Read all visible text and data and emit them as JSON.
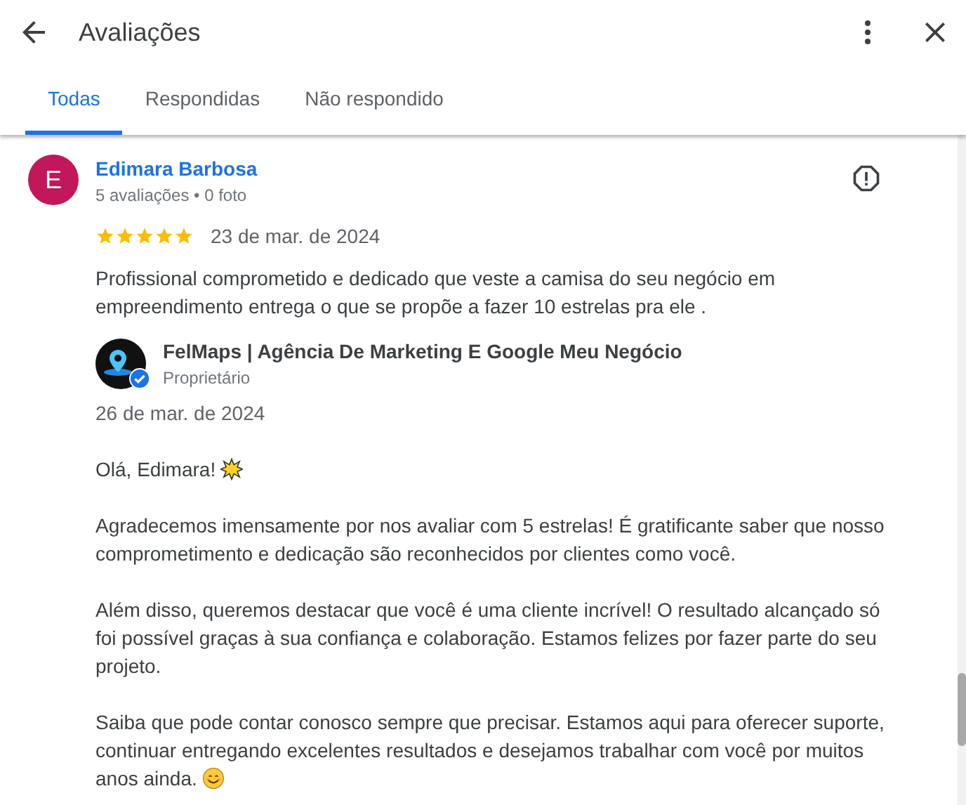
{
  "header": {
    "title": "Avaliações"
  },
  "tabs": [
    {
      "label": "Todas",
      "selected": true
    },
    {
      "label": "Respondidas",
      "selected": false
    },
    {
      "label": "Não respondido",
      "selected": false
    }
  ],
  "review": {
    "avatar_letter": "E",
    "author": "Edimara Barbosa",
    "meta": "5 avaliações • 0 foto",
    "stars": 5,
    "date": "23 de mar. de 2024",
    "text": "Profissional comprometido e dedicado que veste a camisa do seu negócio em empreendimento entrega o que se propõe a fazer 10 estrelas pra ele .",
    "reply": {
      "owner": "FelMaps | Agência De Marketing E Google Meu Negócio",
      "role": "Proprietário",
      "verified": true,
      "date": "26 de mar. de 2024",
      "paragraphs": [
        {
          "text": "Olá, Edimara!",
          "kind": "greeting_with_sparkle"
        },
        {
          "text": "Agradecemos imensamente por nos avaliar com 5 estrelas! É gratificante saber que nosso comprometimento e dedicação são reconhecidos por clientes como você."
        },
        {
          "text": "Além disso, queremos destacar que você é uma cliente incrível! O resultado alcançado só foi possível graças à sua confiança e colaboração. Estamos felizes por fazer parte do seu projeto."
        },
        {
          "text": "Saiba que pode contar conosco sempre que precisar. Estamos aqui para oferecer suporte, continuar entregando excelentes resultados e desejamos trabalhar com você por muitos anos ainda.",
          "kind": "closing_with_smile"
        }
      ]
    }
  }
}
